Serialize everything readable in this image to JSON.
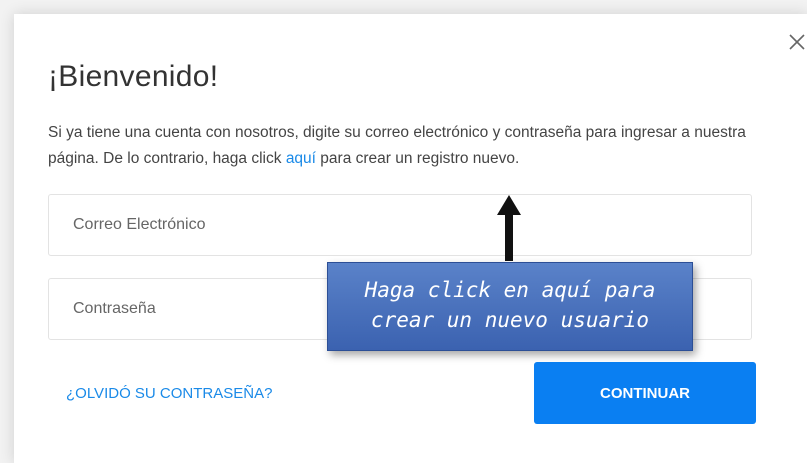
{
  "dialog": {
    "title": "¡Bienvenido!",
    "intro_text": "Si ya tiene una cuenta con nosotros, digite su correo electrónico y contraseña para ingresar a nuestra página. De lo contrario, haga click ",
    "intro_link": "aquí",
    "intro_text_after": " para crear un registro nuevo.",
    "close_icon": "close-icon",
    "email_placeholder": "Correo Electrónico",
    "password_placeholder": "Contraseña",
    "forgot_password_label": "¿OLVIDÓ SU CONTRASEÑA?",
    "continue_label": "CONTINUAR"
  },
  "annotation": {
    "callout_line1": "Haga click en aquí para",
    "callout_line2": "crear un nuevo usuario",
    "arrow_icon": "arrow-up-icon"
  },
  "colors": {
    "accent": "#0a7ff2",
    "link": "#1a8ae8",
    "callout_bg": "#4a72bd"
  }
}
